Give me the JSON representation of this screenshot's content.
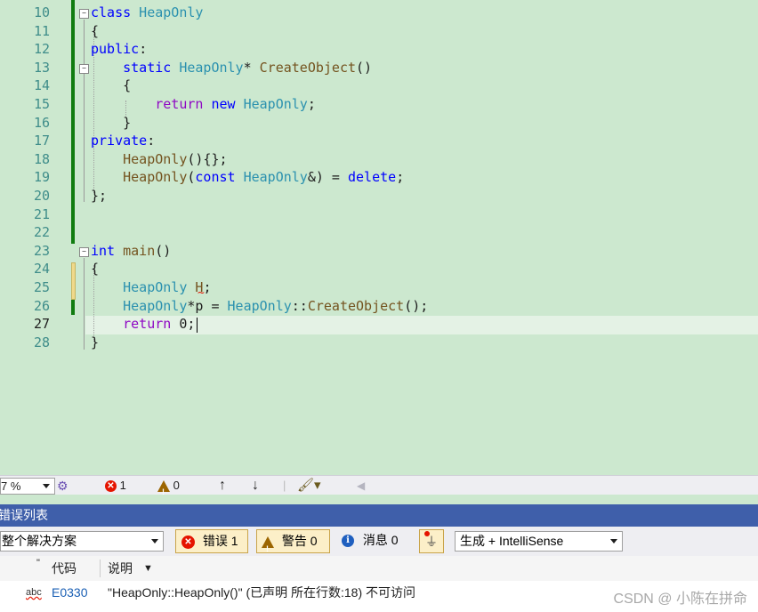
{
  "editor": {
    "lines": [
      {
        "n": "10",
        "tokens": [
          [
            "kw",
            "class"
          ],
          [
            "",
            ""
          ],
          [
            "ty",
            " HeapOnly"
          ]
        ]
      },
      {
        "n": "11",
        "tokens": [
          [
            "",
            "{"
          ]
        ]
      },
      {
        "n": "12",
        "tokens": [
          [
            "kw",
            "public"
          ],
          [
            "",
            ":"
          ]
        ]
      },
      {
        "n": "13",
        "tokens": [
          [
            "",
            "    "
          ],
          [
            "kw",
            "static"
          ],
          [
            "",
            ""
          ],
          [
            "ty",
            " HeapOnly"
          ],
          [
            "",
            "* "
          ],
          [
            "fn",
            "CreateObject"
          ],
          [
            "",
            "()"
          ]
        ]
      },
      {
        "n": "14",
        "tokens": [
          [
            "",
            "    {"
          ]
        ]
      },
      {
        "n": "15",
        "tokens": [
          [
            "",
            "        "
          ],
          [
            "ctl",
            "return"
          ],
          [
            "",
            ""
          ],
          [
            "kw",
            " new"
          ],
          [
            "ty",
            " HeapOnly"
          ],
          [
            "",
            ";"
          ]
        ]
      },
      {
        "n": "16",
        "tokens": [
          [
            "",
            "    }"
          ]
        ]
      },
      {
        "n": "17",
        "tokens": [
          [
            "kw",
            "private"
          ],
          [
            "",
            ":"
          ]
        ]
      },
      {
        "n": "18",
        "tokens": [
          [
            "",
            "    "
          ],
          [
            "fn",
            "HeapOnly"
          ],
          [
            "",
            "(){};"
          ]
        ]
      },
      {
        "n": "19",
        "tokens": [
          [
            "",
            "    "
          ],
          [
            "fn",
            "HeapOnly"
          ],
          [
            "",
            "("
          ],
          [
            "kw",
            "const"
          ],
          [
            "ty",
            " HeapOnly"
          ],
          [
            "",
            "&) = "
          ],
          [
            "kw",
            "delete"
          ],
          [
            "",
            ";"
          ]
        ]
      },
      {
        "n": "20",
        "tokens": [
          [
            "",
            "};"
          ]
        ]
      },
      {
        "n": "21",
        "tokens": []
      },
      {
        "n": "22",
        "tokens": []
      },
      {
        "n": "23",
        "tokens": [
          [
            "kw",
            "int"
          ],
          [
            "",
            ""
          ],
          [
            "fn",
            " main"
          ],
          [
            "",
            "()"
          ]
        ]
      },
      {
        "n": "24",
        "tokens": [
          [
            "",
            "{"
          ]
        ]
      },
      {
        "n": "25",
        "tokens": [
          [
            "",
            "    "
          ],
          [
            "ty",
            "HeapOnly"
          ],
          [
            "",
            ""
          ],
          [
            "fn",
            " H"
          ],
          [
            "",
            ";"
          ]
        ]
      },
      {
        "n": "26",
        "tokens": [
          [
            "",
            "    "
          ],
          [
            "ty",
            "HeapOnly"
          ],
          [
            "",
            "*p = "
          ],
          [
            "ty",
            "HeapOnly"
          ],
          [
            "",
            "::"
          ],
          [
            "fn",
            "CreateObject"
          ],
          [
            "",
            "();"
          ]
        ]
      },
      {
        "n": "27",
        "tokens": [
          [
            "",
            "    "
          ],
          [
            "ctl",
            "return"
          ],
          [
            "",
            " 0;"
          ]
        ]
      },
      {
        "n": "28",
        "tokens": [
          [
            "",
            "}"
          ]
        ]
      }
    ]
  },
  "statusbar": {
    "zoom": "7 %",
    "errors": "1",
    "warnings": "0"
  },
  "panel": {
    "title": "错误列表",
    "scope": "整个解决方案",
    "errors_label": "错误 1",
    "warnings_label": "警告 0",
    "messages_label": "消息 0",
    "build_source": "生成 + IntelliSense",
    "columns": {
      "code": "代码",
      "description": "说明"
    },
    "rows": [
      {
        "icon": "abc",
        "code": "E0330",
        "description": "\"HeapOnly::HeapOnly()\" (已声明 所在行数:18) 不可访问"
      }
    ]
  },
  "watermark": "CSDN @ ​​小陈在拼命​​",
  "colors": {
    "editor_bg": "#cce8cf",
    "keyword": "#0000ff",
    "type": "#2b91af",
    "function": "#74531f",
    "control": "#8f08c4",
    "panel_title_bg": "#3f5faa",
    "change_bar": "#107c10"
  }
}
